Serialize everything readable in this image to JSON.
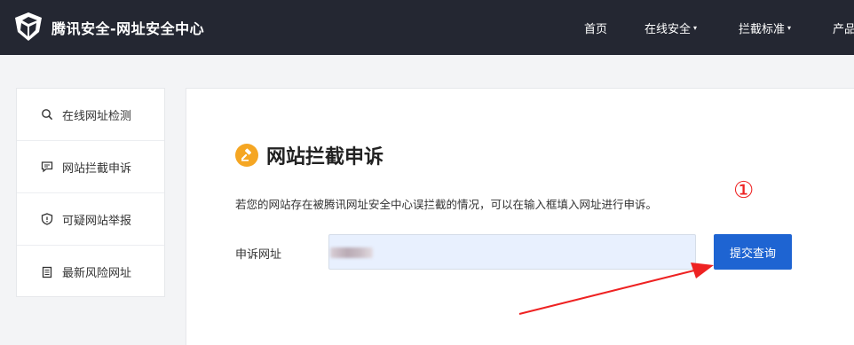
{
  "header": {
    "brand": "腾讯安全-网址安全中心",
    "nav": [
      {
        "label": "首页",
        "caret": ""
      },
      {
        "label": "在线安全",
        "caret": "▾"
      },
      {
        "label": "拦截标准",
        "caret": "▾"
      },
      {
        "label": "产品",
        "caret": ""
      }
    ]
  },
  "sidebar": {
    "items": [
      {
        "label": "在线网址检测",
        "icon": "search-icon"
      },
      {
        "label": "网站拦截申诉",
        "icon": "chat-icon"
      },
      {
        "label": "可疑网站举报",
        "icon": "shield-icon"
      },
      {
        "label": "最新风险网址",
        "icon": "document-icon"
      }
    ]
  },
  "main": {
    "title": "网站拦截申诉",
    "title_icon": "gavel-icon",
    "description": "若您的网站存在被腾讯网址安全中心误拦截的情况，可以在输入框填入网址进行申诉。",
    "field_label": "申诉网址",
    "url_value": "",
    "submit_label": "提交查询"
  },
  "annotation": {
    "marker": "①",
    "color": "#ee2222"
  },
  "colors": {
    "topbar": "#242732",
    "primary": "#1e64d2",
    "accent": "#f5a623"
  }
}
